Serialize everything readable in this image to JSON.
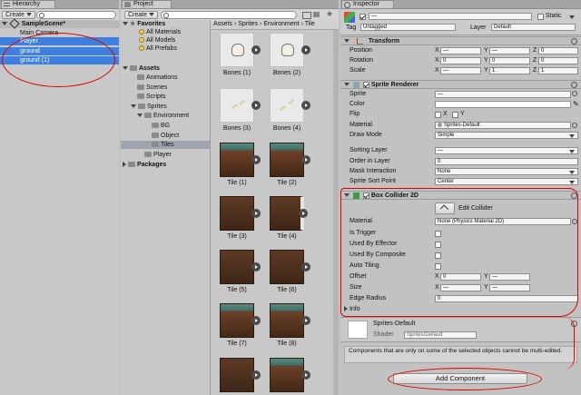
{
  "hierarchy": {
    "tab_label": "Hierarchy",
    "create_label": "Create",
    "scene_name": "SampleScene*",
    "items": [
      {
        "label": "Main Camera",
        "selected": false
      },
      {
        "label": "Player",
        "selected": true
      },
      {
        "label": "ground",
        "selected": true
      },
      {
        "label": "ground (1)",
        "selected": true
      }
    ]
  },
  "project": {
    "tab_label": "Project",
    "create_label": "Create",
    "favorites": {
      "label": "Favorites",
      "items": [
        "All Materials",
        "All Models",
        "All Prefabs"
      ]
    },
    "assets": {
      "label": "Assets",
      "items": [
        "Animations",
        "Scenes",
        "Scripts",
        "Sprites",
        "Environment",
        "BG",
        "Object",
        "Tiles",
        "Player"
      ]
    },
    "packages_label": "Packages",
    "breadcrumb": [
      "Assets",
      "Sprites",
      "Environment",
      "Tile"
    ],
    "grid": [
      {
        "label": "Bones (1)"
      },
      {
        "label": "Bones (2)"
      },
      {
        "label": "Bones (3)"
      },
      {
        "label": "Bones (4)"
      },
      {
        "label": "Tile (1)"
      },
      {
        "label": "Tile (2)"
      },
      {
        "label": "Tile (3)"
      },
      {
        "label": "Tile (4)"
      },
      {
        "label": "Tile (5)"
      },
      {
        "label": "Tile (6)"
      },
      {
        "label": "Tile (7)"
      },
      {
        "label": "Tile (8)"
      }
    ]
  },
  "inspector": {
    "tab_label": "Inspector",
    "static_label": "Static",
    "tag_label": "Tag",
    "tag_value": "Untagged",
    "layer_label": "Layer",
    "layer_value": "Default",
    "transform": {
      "title": "Transform",
      "position_label": "Position",
      "rotation_label": "Rotation",
      "scale_label": "Scale",
      "axis_x": "X",
      "axis_y": "Y",
      "axis_z": "Z",
      "position": [
        "—",
        "—",
        "0"
      ],
      "rotation": [
        "0",
        "0",
        "0"
      ],
      "scale": [
        "—",
        "1",
        "1"
      ]
    },
    "sprite_renderer": {
      "title": "Sprite Renderer",
      "sprite_label": "Sprite",
      "sprite_value": "—",
      "color_label": "Color",
      "flip_label": "Flip",
      "flip_x": "X",
      "flip_y": "Y",
      "material_label": "Material",
      "material_value": "Sprites-Default",
      "draw_mode_label": "Draw Mode",
      "draw_mode_value": "Simple",
      "sorting_layer_label": "Sorting Layer",
      "sorting_layer_value": "—",
      "order_label": "Order in Layer",
      "order_value": "0",
      "mask_label": "Mask Interaction",
      "mask_value": "None",
      "sort_point_label": "Sprite Sort Point",
      "sort_point_value": "Center"
    },
    "box_collider": {
      "title": "Box Collider 2D",
      "edit_collider_label": "Edit Collider",
      "material_label": "Material",
      "material_value": "None (Physics Material 2D)",
      "is_trigger_label": "Is Trigger",
      "used_by_effector_label": "Used By Effector",
      "used_by_composite_label": "Used By Composite",
      "auto_tiling_label": "Auto Tiling",
      "offset_label": "Offset",
      "offset_x": "0",
      "offset_y": "—",
      "size_label": "Size",
      "size_x": "—",
      "size_y": "—",
      "edge_radius_label": "Edge Radius",
      "edge_radius_value": "0",
      "axis_x": "X",
      "axis_y": "Y",
      "info_label": "Info"
    },
    "material_preview": {
      "name": "Sprites-Default",
      "shader_label": "Shader",
      "shader_value": "Sprites/Default"
    },
    "note": "Components that are only on some of the selected objects cannot be multi-edited.",
    "add_component_label": "Add Component"
  },
  "colors": {
    "selection": "#3d80df",
    "annotation": "#e00000"
  }
}
